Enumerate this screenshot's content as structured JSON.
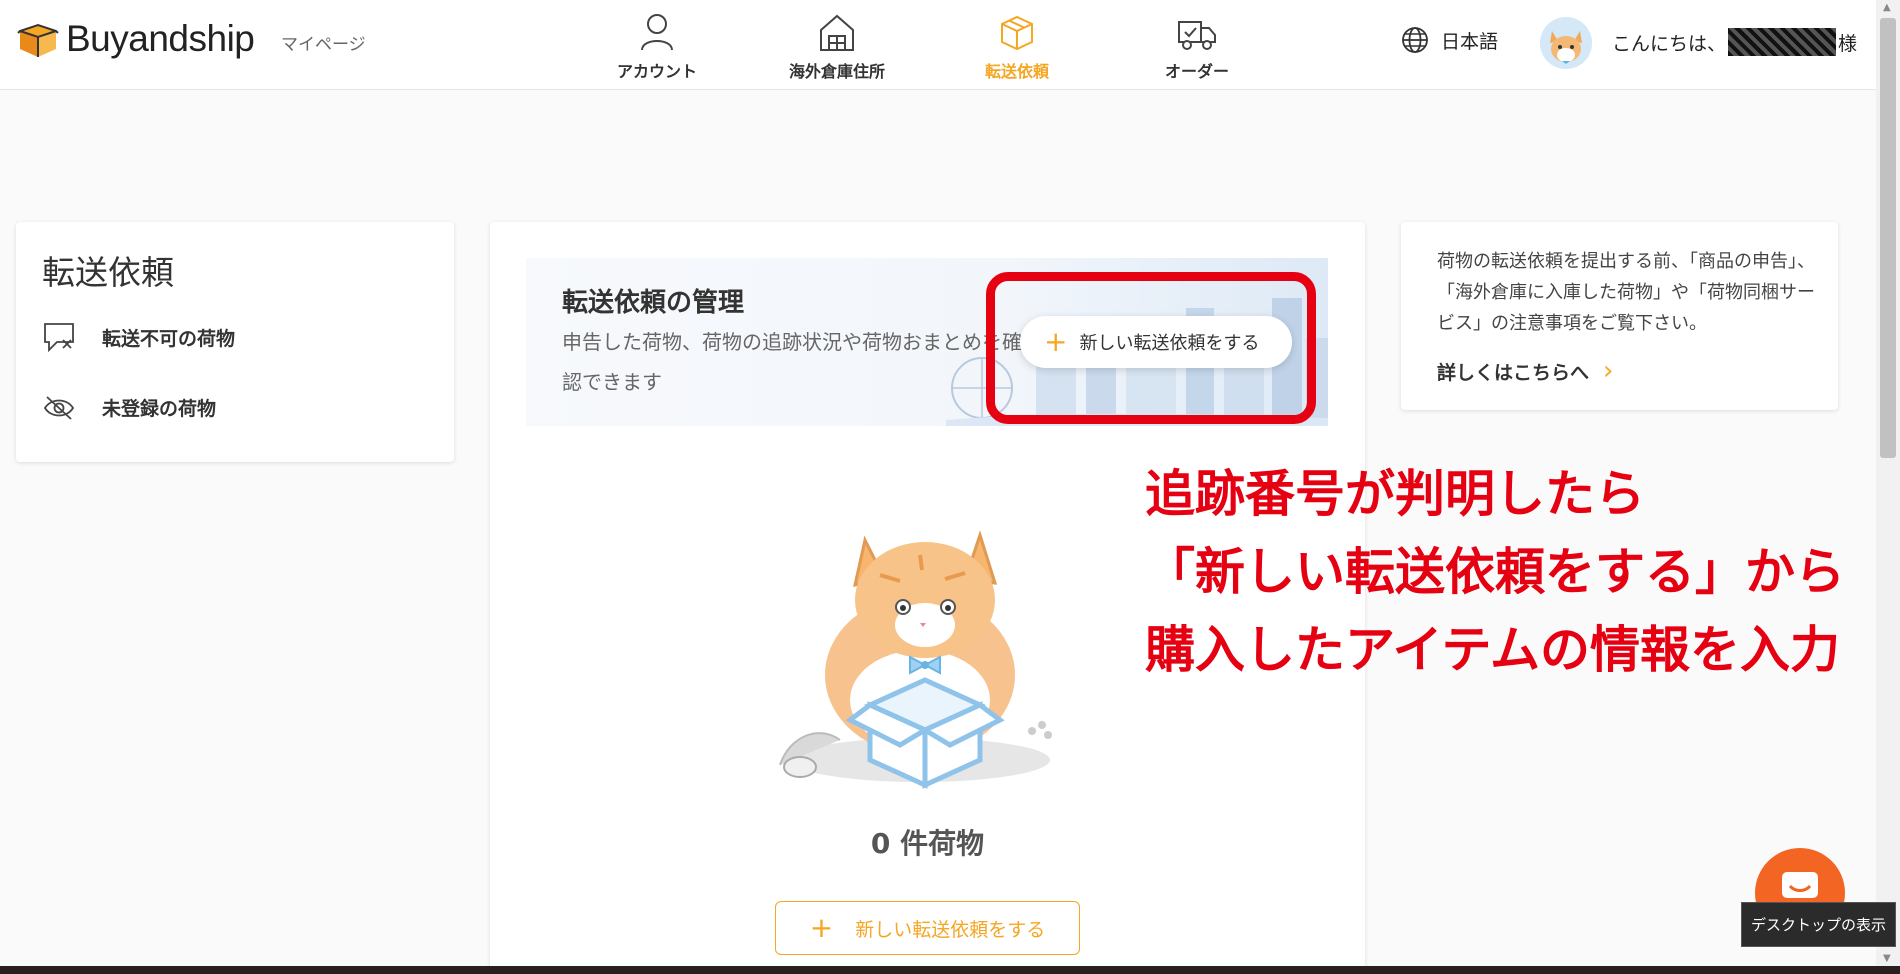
{
  "header": {
    "logo": "Buyandship",
    "mypage": "マイページ",
    "nav": [
      {
        "label": "アカウント",
        "icon": "person-icon"
      },
      {
        "label": "海外倉庫住所",
        "icon": "warehouse-icon"
      },
      {
        "label": "転送依頼",
        "icon": "box-icon",
        "active": true
      },
      {
        "label": "オーダー",
        "icon": "truck-icon"
      }
    ],
    "language": "日本語",
    "greeting_prefix": "こんにちは、",
    "greeting_suffix": "様"
  },
  "sidebar": {
    "title": "転送依頼",
    "items": [
      {
        "label": "転送不可の荷物",
        "icon": "rejected-package-icon"
      },
      {
        "label": "未登録の荷物",
        "icon": "hidden-eye-icon"
      }
    ]
  },
  "main": {
    "banner_title": "転送依頼の管理",
    "banner_desc": "申告した荷物、荷物の追跡状況や荷物おまとめを確認できます",
    "new_request_top": "新しい転送依頼をする",
    "count_label": "0 件荷物",
    "new_request_bottom": "新しい転送依頼をする"
  },
  "info": {
    "text": "荷物の転送依頼を提出する前、「商品の申告」、「海外倉庫に入庫した荷物」や「荷物同梱サービス」の注意事項をご覧下さい。",
    "link": "詳しくはこちらへ"
  },
  "annotation": {
    "lines": [
      "追跡番号が判明したら",
      "「新しい転送依頼をする」から",
      "購入したアイテムの情報を入力"
    ]
  },
  "tooltip": "デスクトップの表示",
  "colors": {
    "accent": "#f5a623",
    "annotation_red": "#e50012",
    "chat_button": "#f26522"
  }
}
